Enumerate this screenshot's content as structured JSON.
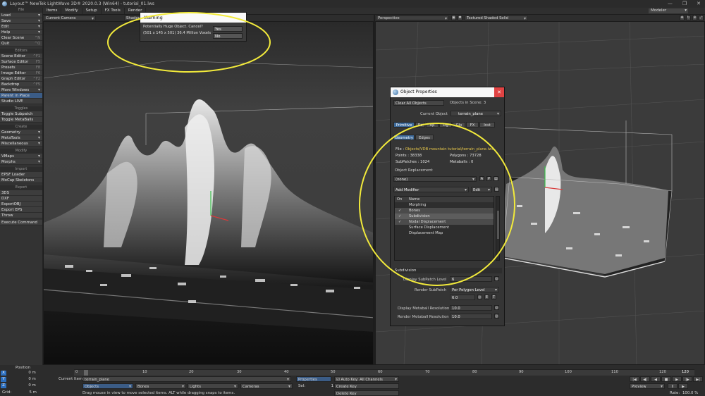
{
  "window": {
    "title": "Layout™ NewTek LightWave 3D® 2020.0.3 (Win64) - tutorial_01.lws",
    "controls": [
      "—",
      "❐",
      "✕"
    ]
  },
  "left_panel": {
    "file_header": "File",
    "file_items": [
      {
        "label": "Load"
      },
      {
        "label": "Save"
      },
      {
        "label": "Edit"
      },
      {
        "label": "Help"
      }
    ],
    "clear_scene": "Clear Scene",
    "clear_scene_sc": "^N",
    "quit": "Quit",
    "quit_sc": "^Q",
    "editors_header": "Editors",
    "editors": [
      {
        "label": "Scene Editor",
        "sc": "^F1"
      },
      {
        "label": "Surface Editor",
        "sc": "F5"
      },
      {
        "label": "Presets",
        "sc": "F8"
      },
      {
        "label": "Image Editor",
        "sc": "F6"
      },
      {
        "label": "Graph Editor",
        "sc": "^F2"
      },
      {
        "label": "Backdrop",
        "sc": "^F5"
      }
    ],
    "more_windows": "More Windows",
    "parent_in_place": "Parent in Place",
    "studio_live": "Studio LIVE",
    "toggles_header": "Toggles",
    "toggle_subpatch": "Toggle Subpatch",
    "toggle_metaballs": "Toggle MetaBalls",
    "create_header": "Create",
    "create_items": [
      "Geometry",
      "MetaTools",
      "Miscellaneous"
    ],
    "modify_header": "Modify",
    "modify_items": [
      "VMaps",
      "Morphs"
    ],
    "import_header": "Import",
    "import_items": [
      "EPSF Loader",
      "MoCap Skeletons"
    ],
    "export_header": "Export",
    "export_items": [
      "3DS",
      "DXF",
      "ExportOBJ",
      "Export EPS",
      "Throw"
    ],
    "execute_command": "Execute Command"
  },
  "menubar": {
    "tabs": [
      "Items",
      "Modify",
      "Setup",
      "FX Tools",
      "Render"
    ],
    "modeler": "Modeler"
  },
  "left_viewport": {
    "view": "Current Camera",
    "shading": "Shaded"
  },
  "right_viewport": {
    "view": "Perspective",
    "shading": "Textured Shaded Solid"
  },
  "warning": {
    "title": "Warning",
    "line1": "Potentially Huge Object.  Cancel?",
    "line2": "(501 x 145 x 501)  36.4 Million  Voxels",
    "yes": "Yes",
    "no": "No"
  },
  "object_properties": {
    "title": "Object Properties",
    "close": "✕",
    "clear_all": "Clear All Objects",
    "objects_in_scene": "Objects in Scene: 3",
    "current_object_label": "Current Object",
    "current_object": "terrain_plane",
    "tabs": [
      "Primitive",
      "Re",
      "Ap",
      "Lig",
      "Glo",
      "FX",
      "Inst"
    ],
    "subtabs": [
      "Geometry",
      "Edges"
    ],
    "file_label": "File :",
    "file_path": "Objects/VDB mountain tutorial/terrain_plane.lwo",
    "points": "Points : 38338",
    "polygons": "Polygons : 73728",
    "subpatches": "SubPatches : 1024",
    "metaballs": "Metaballs : 0",
    "object_replacement": "Object Replacement",
    "replacement_value": "(none)",
    "add_modifier": "Add Modifier",
    "edit": "Edit",
    "list_headers": [
      "On",
      "Name"
    ],
    "modifiers": [
      {
        "on": "",
        "name": "Morphing"
      },
      {
        "on": "✓",
        "name": "Bones"
      },
      {
        "on": "✓",
        "name": "Subdivision"
      },
      {
        "on": "✓",
        "name": "Nodal Displacement"
      },
      {
        "on": "",
        "name": "Surface Displacement"
      },
      {
        "on": "",
        "name": "Displacement Map"
      }
    ],
    "subdivision_section": "Subdivision",
    "display_subpatch_label": "Display SubPatch Level",
    "display_subpatch_value": "6",
    "render_subpatch_label": "Render SubPatch",
    "render_subpatch_value": "Per Polygon Level",
    "render_subpatch_level": "6.0",
    "display_metaball_label": "Display Metaball Resolution",
    "display_metaball_value": "10.0",
    "render_metaball_label": "Render Metaball Resolution",
    "render_metaball_value": "10.0"
  },
  "timeline": {
    "position_label": "Position",
    "x_val": "0 m",
    "y_val": "0 m",
    "z_val": "0 m",
    "grid_label": "Grid:",
    "grid_val": "5 m",
    "ticks": [
      "0",
      "10",
      "20",
      "30",
      "40",
      "50",
      "60",
      "70",
      "80",
      "90",
      "100",
      "110",
      "120"
    ],
    "end_frame": "120",
    "current_item_label": "Current Item",
    "current_item": "terrain_plane",
    "objects": "Objects",
    "bones": "Bones",
    "lights": "Lights",
    "cameras": "Cameras",
    "properties": "Properties",
    "sel_label": "Sel:",
    "sel_val": "1",
    "auto_key": "Auto Key: All Channels",
    "create_key": "Create Key",
    "delete_key": "Delete Key",
    "status": "Drag mouse in view to move selected items. ALT while dragging snaps to items.",
    "preview": "Preview",
    "rate_label": "Rate:",
    "rate_val": "100.0 %"
  },
  "accent_colors": {
    "selection_blue": "#3b5c86",
    "tab_blue": "#3d6a9a",
    "annotation_yellow": "#f2ea3b",
    "x_axis": "#c0392b",
    "y_axis": "#27ae60",
    "z_axis": "#2c6fbf"
  }
}
